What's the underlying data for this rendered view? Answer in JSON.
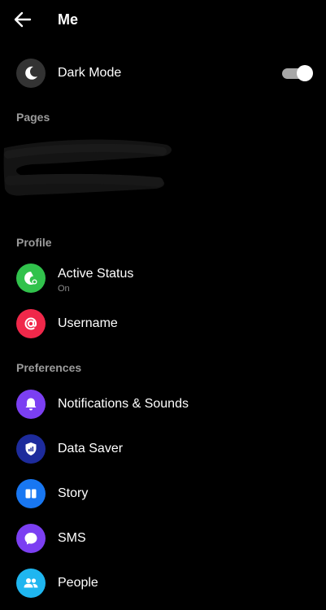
{
  "header": {
    "title": "Me",
    "back_icon": "arrow-left-icon"
  },
  "dark_mode": {
    "label": "Dark Mode",
    "icon": "moon-icon",
    "icon_bg": "#333333",
    "enabled": true
  },
  "sections": {
    "pages": "Pages",
    "profile": "Profile",
    "preferences": "Preferences"
  },
  "profile_items": {
    "active_status": {
      "label": "Active Status",
      "sublabel": "On",
      "icon": "active-status-icon",
      "icon_bg": "#31c24c"
    },
    "username": {
      "label": "Username",
      "icon": "at-sign-icon",
      "icon_bg": "#f0284a"
    }
  },
  "preference_items": {
    "notifications": {
      "label": "Notifications & Sounds",
      "icon": "bell-icon",
      "icon_bg": "#7b3ff2"
    },
    "data_saver": {
      "label": "Data Saver",
      "icon": "shield-icon",
      "icon_bg": "#1d2b9c"
    },
    "story": {
      "label": "Story",
      "icon": "story-icon",
      "icon_bg": "#1877f2"
    },
    "sms": {
      "label": "SMS",
      "icon": "chat-bubble-icon",
      "icon_bg": "#7b3ff2"
    },
    "people": {
      "label": "People",
      "icon": "people-icon",
      "icon_bg": "#1fb6f0"
    }
  }
}
